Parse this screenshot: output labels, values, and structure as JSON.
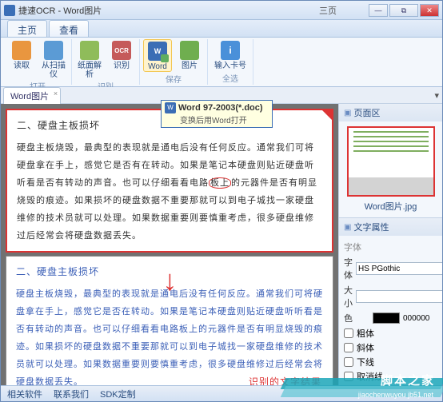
{
  "window": {
    "title": "捷速OCR - Word图片",
    "page_count": "三页"
  },
  "tabs": {
    "home": "主页",
    "view": "查看"
  },
  "ribbon": {
    "open": {
      "read": "读取",
      "scanner": "从扫描仪",
      "label": "打开"
    },
    "recog": {
      "parse": "纸面解析",
      "ocr": "OCR",
      "ocr_label": "识别",
      "label": "识别"
    },
    "save": {
      "word": "Word",
      "image": "图片",
      "label": "保存"
    },
    "other": {
      "card": "输入卡号",
      "label": "全选"
    }
  },
  "doc": {
    "tab": "Word图片"
  },
  "tooltip": {
    "line1": "Word 97-2003(*.doc)",
    "line2": "变换后用Word打开"
  },
  "page_top": {
    "heading": "二、硬盘主板损坏",
    "body1": "硬盘主板烧毁，最典型的表现就是通电后没有任何反应。通常我们可将硬盘拿在手上，感觉它是否有在转动。如果是笔记本硬盘则贴近硬盘听听看是否有转动的声音。也可以仔细看看电路",
    "body1_em": "板上",
    "body1_tail": "的元器件是否有明显烧毁的痕迹。如果损坏的硬盘数据不重要那就可以到电子城找一家硬盘维修的技术员就可以处理。如果数据重要则要慎重考虑，很多硬盘维修过后经常会将硬盘数据丢失。"
  },
  "page_bot": {
    "heading": "二、硬盘主板损坏",
    "body": "硬盘主板烧毁，最典型的表现就是通电后没有任何反应。通常我们可将硬盘拿在手上，感觉它是否在转动。如果是笔记本硬盘则贴近硬盘听听看是否有转动的声音。也可以仔细看看电路板上的元器件是否有明显烧毁的痕迹。如果损坏的硬盘数据不重要那就可以到电子城找一家硬盘维修的技术员就可以处理。如果数据重要则要慎重考虑，很多硬盘维修过后经常会将硬盘数据丢失。",
    "result_label": "识别的文字结果"
  },
  "sidebar": {
    "pages": {
      "title": "页面区",
      "thumb_label": "Word图片.jpg"
    },
    "props": {
      "title": "文字属性",
      "group": "字体",
      "font_label": "字体",
      "font_value": "HS PGothic",
      "size_label": "大小",
      "color_label": "色",
      "color_value": "000000",
      "bold": "粗体",
      "italic": "斜体",
      "underline": "下线",
      "strike": "取消线"
    }
  },
  "status": {
    "related": "相关软件",
    "contact": "联系我们",
    "sdk": "SDK定制"
  },
  "watermark": {
    "text": "脚本之家",
    "url": "jiaochenwuyou  jb51.net"
  }
}
